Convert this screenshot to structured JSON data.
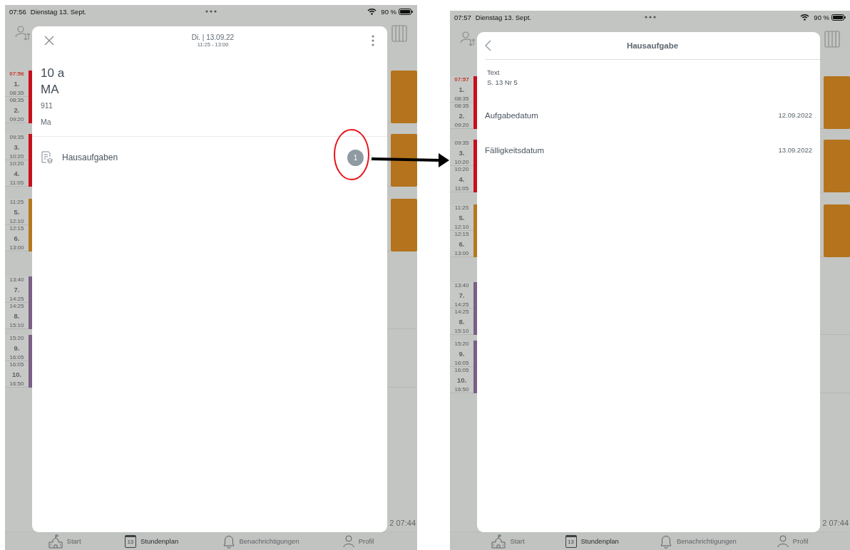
{
  "screens": [
    {
      "status_bar": {
        "time": "07:56",
        "date": "Dienstag 13. Sept.",
        "battery": "90 %"
      },
      "groups": [
        {
          "color": "#c8101c",
          "lesson": true,
          "periods": [
            {
              "start": "07:56",
              "number": "1.",
              "end": "08:35",
              "current": true
            },
            {
              "start": "08:35",
              "number": "2.",
              "end": "09:20",
              "current": false
            }
          ]
        },
        {
          "color": "#c8101c",
          "lesson": true,
          "periods": [
            {
              "start": "09:35",
              "number": "3.",
              "end": "10:20",
              "current": false
            },
            {
              "start": "10:20",
              "number": "4.",
              "end": "11:05",
              "current": false
            }
          ]
        },
        {
          "color": "#b5781e",
          "lesson": true,
          "periods": [
            {
              "start": "11:25",
              "number": "5.",
              "end": "12:10",
              "current": false
            },
            {
              "start": "12:15",
              "number": "6.",
              "end": "13:00",
              "current": false
            }
          ]
        },
        {
          "color": "#7a5f86",
          "lesson": false,
          "periods": [
            {
              "start": "13:40",
              "number": "7.",
              "end": "14:25",
              "current": false
            },
            {
              "start": "14:25",
              "number": "8.",
              "end": "15:10",
              "current": false
            }
          ]
        },
        {
          "color": "#7a5f86",
          "lesson": false,
          "periods": [
            {
              "start": "15:20",
              "number": "9.",
              "end": "16:05",
              "current": false
            },
            {
              "start": "16:05",
              "number": "10.",
              "end": "16:50",
              "current": false
            }
          ]
        }
      ],
      "footer_text": "2 07:44",
      "tabs": [
        {
          "kind": "school",
          "label": "Start",
          "selected": false
        },
        {
          "kind": "calendar",
          "icon_text": "13",
          "label": "Stundenplan",
          "selected": true
        },
        {
          "kind": "bell",
          "label": "Benachrichtigungen",
          "selected": false
        },
        {
          "kind": "person",
          "label": "Profil",
          "selected": false
        }
      ],
      "modal": {
        "kind": "lesson",
        "title": "Di. | 13.09.22",
        "subtitle": "11:25 - 13:00",
        "details": [
          {
            "text": "10 a",
            "kind": "large"
          },
          {
            "text": "MA",
            "kind": "large"
          },
          {
            "text": "911",
            "kind": "small"
          },
          {
            "text": "Ma",
            "kind": "small"
          }
        ],
        "rows": [
          {
            "label": "Hausaufgaben",
            "count": "1"
          }
        ]
      }
    },
    {
      "status_bar": {
        "time": "07:57",
        "date": "Dienstag 13. Sept.",
        "battery": "90 %"
      },
      "groups": [
        {
          "color": "#c8101c",
          "lesson": true,
          "periods": [
            {
              "start": "07:57",
              "number": "1.",
              "end": "08:35",
              "current": true
            },
            {
              "start": "08:35",
              "number": "2.",
              "end": "09:20",
              "current": false
            }
          ]
        },
        {
          "color": "#c8101c",
          "lesson": true,
          "periods": [
            {
              "start": "09:35",
              "number": "3.",
              "end": "10:20",
              "current": false
            },
            {
              "start": "10:20",
              "number": "4.",
              "end": "11:05",
              "current": false
            }
          ]
        },
        {
          "color": "#b5781e",
          "lesson": true,
          "periods": [
            {
              "start": "11:25",
              "number": "5.",
              "end": "12:10",
              "current": false
            },
            {
              "start": "12:15",
              "number": "6.",
              "end": "13:00",
              "current": false
            }
          ]
        },
        {
          "color": "#7a5f86",
          "lesson": false,
          "periods": [
            {
              "start": "13:40",
              "number": "7.",
              "end": "14:25",
              "current": false
            },
            {
              "start": "14:25",
              "number": "8.",
              "end": "15:10",
              "current": false
            }
          ]
        },
        {
          "color": "#7a5f86",
          "lesson": false,
          "periods": [
            {
              "start": "15:20",
              "number": "9.",
              "end": "16:05",
              "current": false
            },
            {
              "start": "16:05",
              "number": "10.",
              "end": "16:50",
              "current": false
            }
          ]
        }
      ],
      "footer_text": "2 07:44",
      "tabs": [
        {
          "kind": "school",
          "label": "Start",
          "selected": false
        },
        {
          "kind": "calendar",
          "icon_text": "13",
          "label": "Stundenplan",
          "selected": true
        },
        {
          "kind": "bell",
          "label": "Benachrichtigungen",
          "selected": false
        },
        {
          "kind": "person",
          "label": "Profil",
          "selected": false
        }
      ],
      "modal": {
        "kind": "homework",
        "title": "Hausaufgabe",
        "fields": [
          {
            "kind": "stacked",
            "label": "Text",
            "value": "S. 13 Nr 5"
          },
          {
            "kind": "inline",
            "label": "Aufgabedatum",
            "value": "12.09.2022"
          },
          {
            "kind": "inline",
            "label": "Fälligkeitsdatum",
            "value": "13.09.2022"
          }
        ]
      }
    }
  ]
}
